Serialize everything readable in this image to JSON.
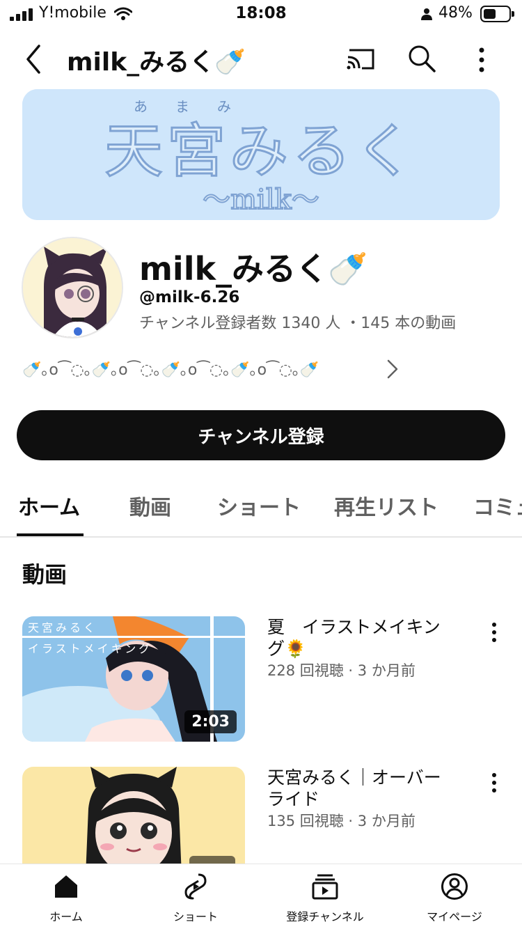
{
  "status_bar": {
    "carrier": "Y!mobile",
    "time": "18:08",
    "battery": "48%"
  },
  "header": {
    "title": "milk_みるく🍼"
  },
  "channel": {
    "name": "milk_みるく🍼",
    "handle": "@milk-6.26",
    "stats": "チャンネル登録者数 1340 人 ・145 本の動画",
    "description": "🍼｡o⁀◌｡🍼｡o⁀◌｡🍼｡o⁀◌｡🍼｡o⁀◌｡🍼"
  },
  "subscribe_label": "チャンネル登録",
  "tabs": [
    "ホーム",
    "動画",
    "ショート",
    "再生リスト",
    "コミュ"
  ],
  "section_title": "動画",
  "videos": [
    {
      "title": "夏　イラストメイキング🌻",
      "meta": "228 回視聴 · 3 か月前",
      "duration": "2:03",
      "thumb_text_1": "天宮みるく",
      "thumb_text_2": "イラストメイキング"
    },
    {
      "title": "天宮みるく｜オーバーライド",
      "meta": "135 回視聴 · 3 か月前"
    }
  ],
  "bottom_nav": [
    {
      "label": "ホーム",
      "icon": "home-icon"
    },
    {
      "label": "ショート",
      "icon": "shorts-icon"
    },
    {
      "label": "登録チャンネル",
      "icon": "subscriptions-icon"
    },
    {
      "label": "マイページ",
      "icon": "account-icon"
    }
  ],
  "banner": {
    "title": "天宮みるく",
    "ruby": "あまみ",
    "subtitle": "〜milk〜"
  }
}
